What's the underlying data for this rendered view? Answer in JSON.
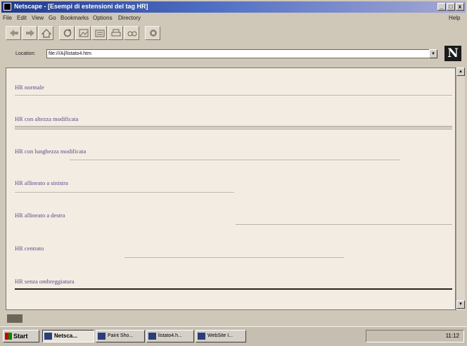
{
  "window": {
    "title": "Netscape - [Esempi di estensioni del tag HR]",
    "controls": [
      "_",
      "□",
      "x"
    ]
  },
  "menu": {
    "items": [
      "File",
      "Edit",
      "View",
      "Go",
      "Bookmarks",
      "Options",
      "Directory"
    ],
    "help": "Help"
  },
  "toolbar": {
    "buttons": [
      "back-icon",
      "forward-icon",
      "home-icon",
      "reload-icon",
      "images-icon",
      "open-icon",
      "print-icon",
      "find-icon",
      "stop-icon"
    ]
  },
  "location": {
    "label": "Location:",
    "value": "file:///A|/listato4.htm",
    "logo": "N"
  },
  "page": {
    "rows": [
      {
        "label": "HR normale"
      },
      {
        "label": "HR con altezza modificata"
      },
      {
        "label": "HR con lunghezza modificata"
      },
      {
        "label": "HR allineato a sinistra"
      },
      {
        "label": "HR allineato a destra"
      },
      {
        "label": "HR centrato"
      },
      {
        "label": "HR senza ombreggiatura"
      }
    ]
  },
  "taskbar": {
    "start": "Start",
    "items": [
      {
        "label": "Netsca..."
      },
      {
        "label": "Paint Sho..."
      },
      {
        "label": "listato4.h..."
      },
      {
        "label": "WebSite I..."
      }
    ],
    "clock": "11:12"
  }
}
